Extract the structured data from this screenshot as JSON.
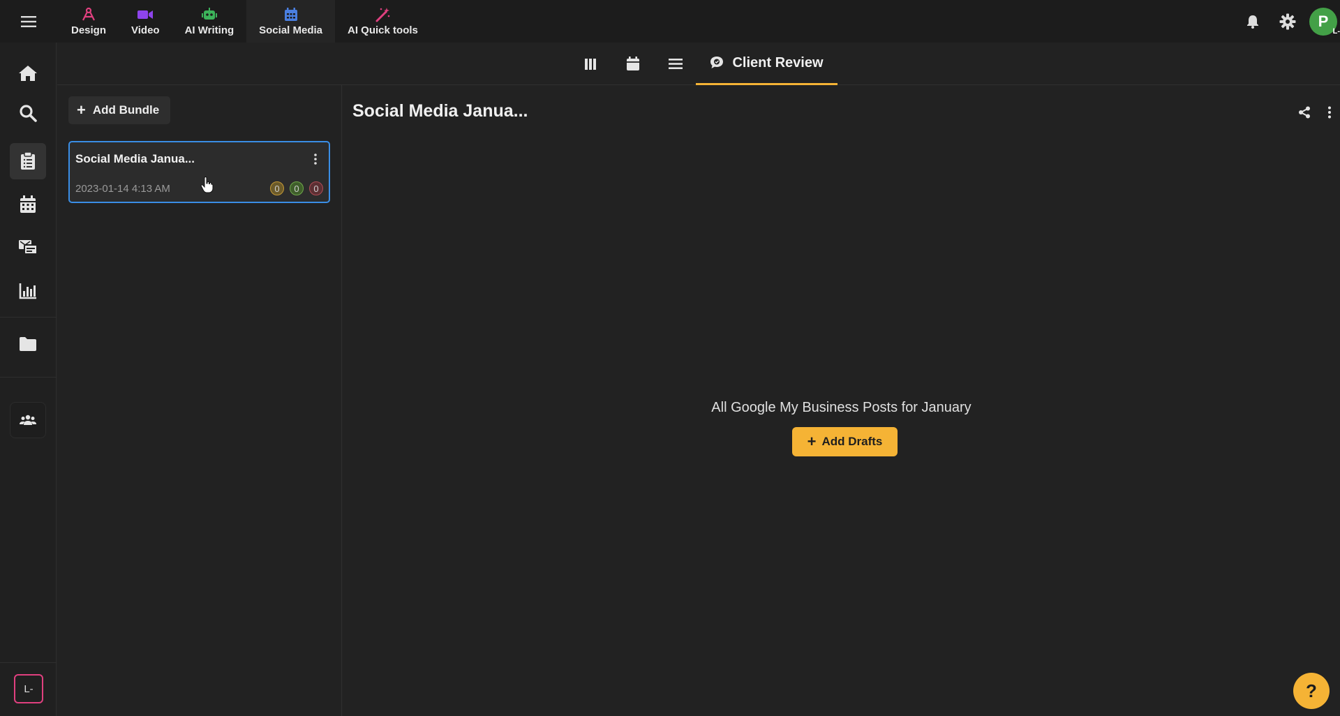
{
  "topbar": {
    "apps": [
      {
        "label": "Design",
        "icon": "design-icon",
        "color": "#e0407f"
      },
      {
        "label": "Video",
        "icon": "video-icon",
        "color": "#8e44ec"
      },
      {
        "label": "AI Writing",
        "icon": "robot-icon",
        "color": "#3cb35a"
      },
      {
        "label": "Social Media",
        "icon": "calendar-icon",
        "color": "#4a7fe0",
        "active": true
      },
      {
        "label": "AI Quick tools",
        "icon": "magic-wand-icon",
        "color": "#e0407f"
      }
    ],
    "avatar_initial": "P",
    "avatar_sub": "L-"
  },
  "sidebar": {
    "items": [
      "home-icon",
      "search-icon",
      "clipboard-icon",
      "calendar-icon",
      "inbox-icon",
      "analytics-icon",
      "folder-icon",
      "team-icon"
    ],
    "active": "clipboard-icon",
    "workspace_badge": "L-"
  },
  "viewbar": {
    "views": [
      "board-view-icon",
      "calendar-view-icon",
      "list-view-icon"
    ],
    "active_label": "Client Review"
  },
  "bundles": {
    "add_label": "Add Bundle",
    "items": [
      {
        "title": "Social Media Janua...",
        "date": "2023-01-14 4:13 AM",
        "counts": [
          "0",
          "0",
          "0"
        ]
      }
    ]
  },
  "main": {
    "title": "Social Media Janua...",
    "empty_message": "All Google My Business Posts for January",
    "add_drafts_label": "Add Drafts"
  },
  "help_label": "?",
  "colors": {
    "accent": "#f5b335",
    "selected_border": "#3a8ee6"
  }
}
